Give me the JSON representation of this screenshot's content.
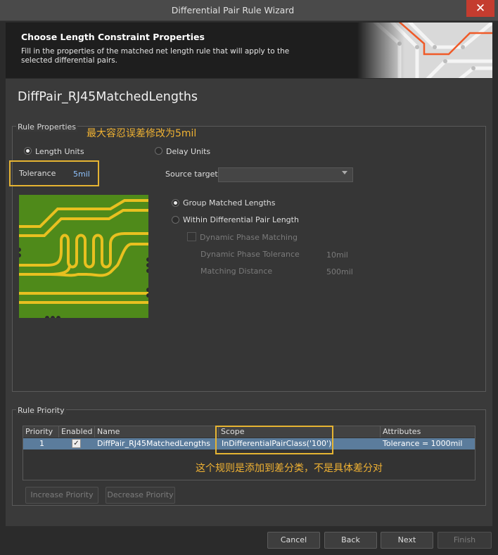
{
  "window": {
    "title": "Differential Pair Rule Wizard",
    "close_glyph": "✕"
  },
  "header": {
    "heading": "Choose Length Constraint Properties",
    "description": "Fill in the properties of the matched net length rule that will apply to the selected differential pairs."
  },
  "rule_name": "DiffPair_RJ45MatchedLengths",
  "rule_properties": {
    "group_label": "Rule Properties",
    "length_units_label": "Length Units",
    "delay_units_label": "Delay Units",
    "units_selected": "Length Units",
    "tolerance_label": "Tolerance",
    "tolerance_value": "5mil",
    "source_target_label": "Source target",
    "source_target_value": "",
    "group_matched_label": "Group Matched Lengths",
    "within_pair_label": "Within Differential Pair Length",
    "match_mode_selected": "Group Matched Lengths",
    "dynamic_phase_label": "Dynamic Phase Matching",
    "dynamic_phase_checked": false,
    "dynamic_tolerance_label": "Dynamic Phase Tolerance",
    "dynamic_tolerance_value": "10mil",
    "matching_distance_label": "Matching Distance",
    "matching_distance_value": "500mil"
  },
  "annotations": {
    "tolerance_note": "最大容忍误差修改为5mil",
    "scope_note": "这个规则是添加到差分类，不是具体差分对"
  },
  "rule_priority": {
    "group_label": "Rule Priority",
    "columns": [
      "Priority",
      "Enabled",
      "Name",
      "Scope",
      "Attributes"
    ],
    "rows": [
      {
        "priority": "1",
        "enabled": true,
        "enabled_glyph": "✓",
        "name": "DiffPair_RJ45MatchedLengths",
        "scope": "InDifferentialPairClass('100')",
        "attributes": "Tolerance = 1000mil"
      }
    ],
    "increase_label": "Increase Priority",
    "decrease_label": "Decrease Priority"
  },
  "footer": {
    "cancel_label": "Cancel",
    "back_label": "Back",
    "next_label": "Next",
    "finish_label": "Finish"
  },
  "colors": {
    "accent_annotation": "#e6b432",
    "selected_row": "#5b7c9c",
    "pcb_board": "#4f8a1a",
    "pcb_trace": "#e8c020"
  }
}
